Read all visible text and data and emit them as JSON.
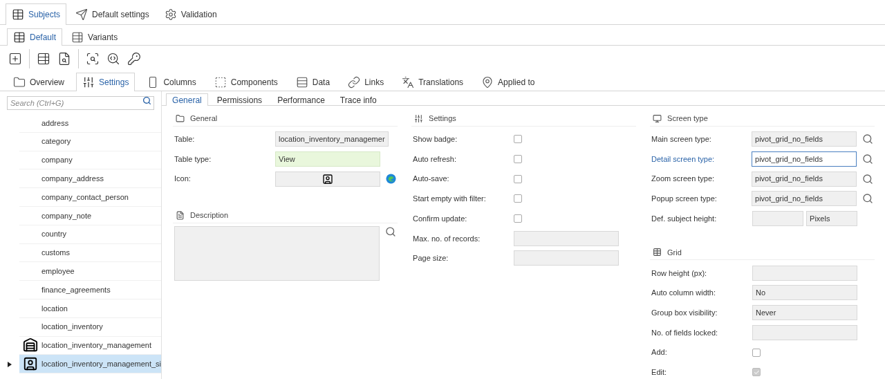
{
  "top_tabs": [
    {
      "label": "Subjects",
      "selected": true
    },
    {
      "label": "Default settings",
      "selected": false
    },
    {
      "label": "Validation",
      "selected": false
    }
  ],
  "sub_tabs": [
    {
      "label": "Default",
      "selected": true
    },
    {
      "label": "Variants",
      "selected": false
    }
  ],
  "section_tabs": [
    {
      "label": "Overview",
      "selected": false
    },
    {
      "label": "Settings",
      "selected": true
    },
    {
      "label": "Columns",
      "selected": false
    },
    {
      "label": "Components",
      "selected": false
    },
    {
      "label": "Data",
      "selected": false
    },
    {
      "label": "Links",
      "selected": false
    },
    {
      "label": "Translations",
      "selected": false
    },
    {
      "label": "Applied to",
      "selected": false
    }
  ],
  "sidebar": {
    "search": {
      "placeholder": "Search (Ctrl+G)"
    },
    "items": [
      {
        "label": "address",
        "kind": "plain",
        "selected": false,
        "has_children": false
      },
      {
        "label": "category",
        "kind": "plain",
        "selected": false,
        "has_children": false
      },
      {
        "label": "company",
        "kind": "plain",
        "selected": false,
        "has_children": false
      },
      {
        "label": "company_address",
        "kind": "plain",
        "selected": false,
        "has_children": false
      },
      {
        "label": "company_contact_person",
        "kind": "plain",
        "selected": false,
        "has_children": false
      },
      {
        "label": "company_note",
        "kind": "plain",
        "selected": false,
        "has_children": false
      },
      {
        "label": "country",
        "kind": "plain",
        "selected": false,
        "has_children": false
      },
      {
        "label": "customs",
        "kind": "plain",
        "selected": false,
        "has_children": false
      },
      {
        "label": "employee",
        "kind": "plain",
        "selected": false,
        "has_children": false
      },
      {
        "label": "finance_agreements",
        "kind": "plain",
        "selected": false,
        "has_children": false
      },
      {
        "label": "location",
        "kind": "plain",
        "selected": false,
        "has_children": false
      },
      {
        "label": "location_inventory",
        "kind": "plain",
        "selected": false,
        "has_children": false
      },
      {
        "label": "location_inventory_management",
        "kind": "building",
        "selected": false,
        "has_children": false
      },
      {
        "label": "location_inventory_management_si",
        "kind": "person",
        "selected": true,
        "has_children": true
      }
    ]
  },
  "detail_tabs": [
    {
      "label": "General",
      "selected": true
    },
    {
      "label": "Permissions",
      "selected": false
    },
    {
      "label": "Performance",
      "selected": false
    },
    {
      "label": "Trace info",
      "selected": false
    }
  ],
  "general": {
    "title": "General",
    "fields": [
      {
        "label": "Table:",
        "kind": "text",
        "value": "location_inventory_managemer",
        "highlighted": false
      },
      {
        "label": "Table type:",
        "kind": "text",
        "value": "View",
        "highlighted": true
      },
      {
        "label": "Icon:",
        "kind": "icon"
      }
    ]
  },
  "description": {
    "title": "Description"
  },
  "settings": {
    "title": "Settings",
    "fields": [
      {
        "label": "Show badge:",
        "kind": "checkbox",
        "checked": false
      },
      {
        "label": "Auto refresh:",
        "kind": "checkbox",
        "checked": false
      },
      {
        "label": "Auto-save:",
        "kind": "checkbox",
        "checked": false
      },
      {
        "label": "Start empty with filter:",
        "kind": "checkbox",
        "checked": false
      },
      {
        "label": "Confirm update:",
        "kind": "checkbox",
        "checked": false
      },
      {
        "label": "Max. no. of records:",
        "kind": "text"
      },
      {
        "label": "Page size:",
        "kind": "text"
      }
    ]
  },
  "screen_type": {
    "title": "Screen type",
    "fields": [
      {
        "label": "Main screen type:",
        "kind": "lookup",
        "value": "pivot_grid_no_fields",
        "focused": false
      },
      {
        "label": "Detail screen type:",
        "kind": "lookup",
        "value": "pivot_grid_no_fields",
        "focused": true
      },
      {
        "label": "Zoom screen type:",
        "kind": "lookup",
        "value": "pivot_grid_no_fields",
        "focused": false
      },
      {
        "label": "Popup screen type:",
        "kind": "lookup",
        "value": "pivot_grid_no_fields",
        "focused": false
      },
      {
        "label": "Def. subject height:",
        "kind": "split",
        "unit": "Pixels"
      }
    ]
  },
  "grid": {
    "title": "Grid",
    "fields": [
      {
        "label": "Row height (px):",
        "kind": "text"
      },
      {
        "label": "Auto column width:",
        "kind": "text",
        "value": "No"
      },
      {
        "label": "Group box visibility:",
        "kind": "text",
        "value": "Never"
      },
      {
        "label": "No. of fields locked:",
        "kind": "text"
      },
      {
        "label": "Add:",
        "kind": "checkbox",
        "checked": false,
        "disabled": false
      },
      {
        "label": "Edit:",
        "kind": "checkbox",
        "checked": true,
        "disabled": true
      }
    ]
  }
}
